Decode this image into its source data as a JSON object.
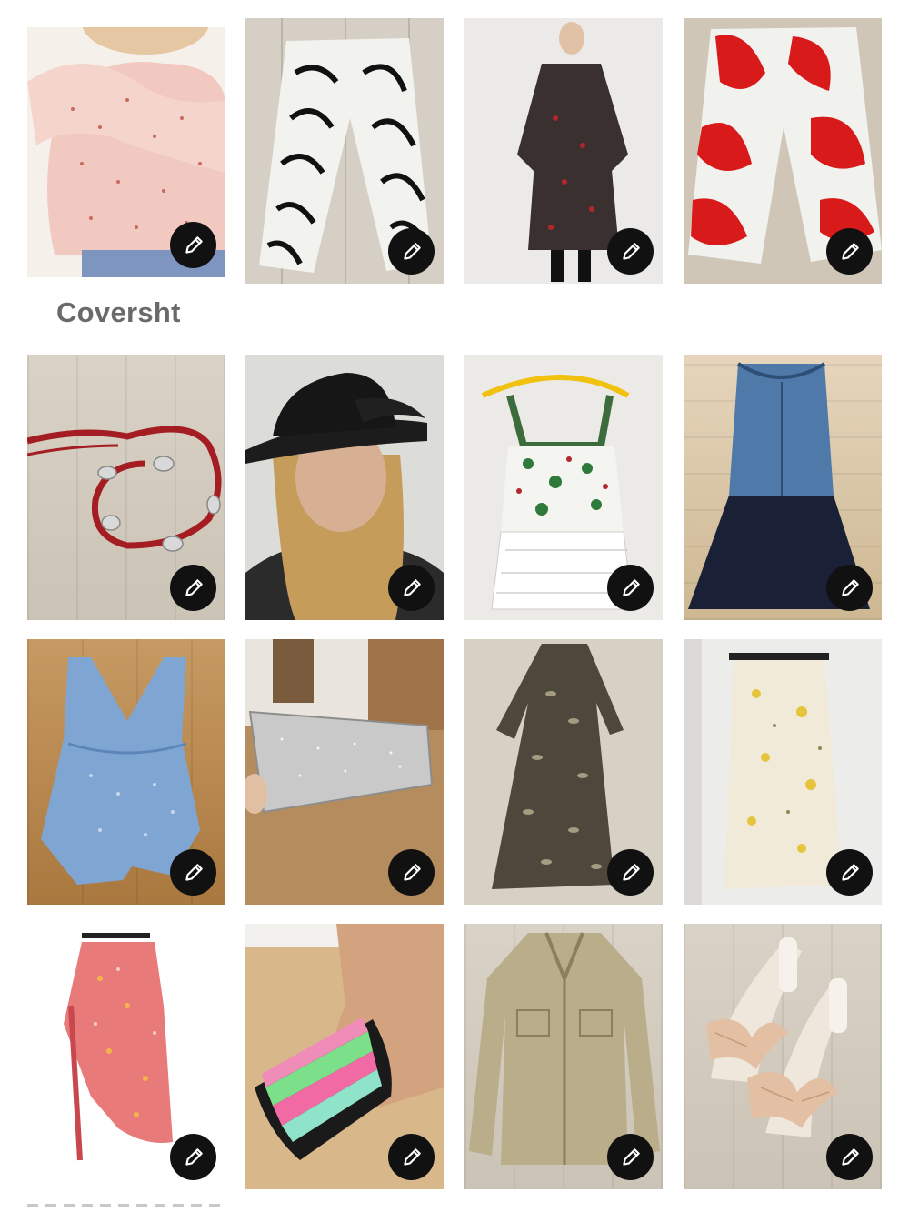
{
  "section": {
    "label": "Coversht"
  },
  "tiles": [
    {
      "name": "floral-ruffle-blouse",
      "edit_icon": "pencil-icon"
    },
    {
      "name": "zebra-palm-pants",
      "edit_icon": "pencil-icon"
    },
    {
      "name": "black-sheer-dress",
      "edit_icon": "pencil-icon"
    },
    {
      "name": "red-print-culottes",
      "edit_icon": "pencil-icon"
    },
    {
      "name": "red-concho-belt",
      "edit_icon": "pencil-icon"
    },
    {
      "name": "black-veiled-hat",
      "edit_icon": "pencil-icon"
    },
    {
      "name": "floral-lace-dress",
      "edit_icon": "pencil-icon"
    },
    {
      "name": "denim-mesh-dress",
      "edit_icon": "pencil-icon"
    },
    {
      "name": "blue-romper",
      "edit_icon": "pencil-icon"
    },
    {
      "name": "silver-clutch",
      "edit_icon": "pencil-icon"
    },
    {
      "name": "leopard-maxi-dress",
      "edit_icon": "pencil-icon"
    },
    {
      "name": "floral-slip-skirt",
      "edit_icon": "pencil-icon"
    },
    {
      "name": "pink-wrap-skirt",
      "edit_icon": "pencil-icon"
    },
    {
      "name": "chevron-cuff-bracelet",
      "edit_icon": "pencil-icon"
    },
    {
      "name": "metallic-jacket",
      "edit_icon": "pencil-icon"
    },
    {
      "name": "bow-heeled-sandals",
      "edit_icon": "pencil-icon"
    }
  ]
}
